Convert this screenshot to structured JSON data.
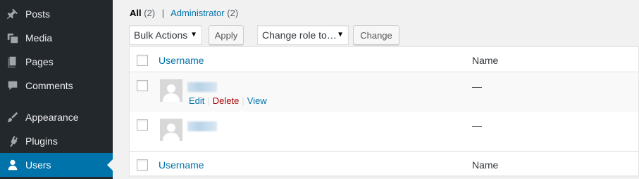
{
  "sidebar": {
    "items": [
      {
        "label": "Posts",
        "icon": "pin-icon"
      },
      {
        "label": "Media",
        "icon": "media-icon"
      },
      {
        "label": "Pages",
        "icon": "pages-icon"
      },
      {
        "label": "Comments",
        "icon": "comment-icon"
      },
      {
        "label": "Appearance",
        "icon": "paintbrush-icon"
      },
      {
        "label": "Plugins",
        "icon": "plugin-icon"
      },
      {
        "label": "Users",
        "icon": "user-icon",
        "active": true
      }
    ]
  },
  "filters": {
    "all_label": "All",
    "all_count": "(2)",
    "separator": "|",
    "admin_label": "Administrator",
    "admin_count": "(2)"
  },
  "toolbar": {
    "bulk_actions": "Bulk Actions",
    "apply": "Apply",
    "change_role": "Change role to…",
    "change": "Change"
  },
  "table": {
    "columns": [
      "Username",
      "Name"
    ],
    "rows": [
      {
        "name": "—",
        "actions": {
          "edit": "Edit",
          "delete": "Delete",
          "view": "View",
          "pipe": "|"
        }
      },
      {
        "name": "—"
      }
    ]
  },
  "colors": {
    "sidebar_bg": "#23282d",
    "active": "#0073aa",
    "link": "#0073aa",
    "delete": "#aa0000"
  }
}
